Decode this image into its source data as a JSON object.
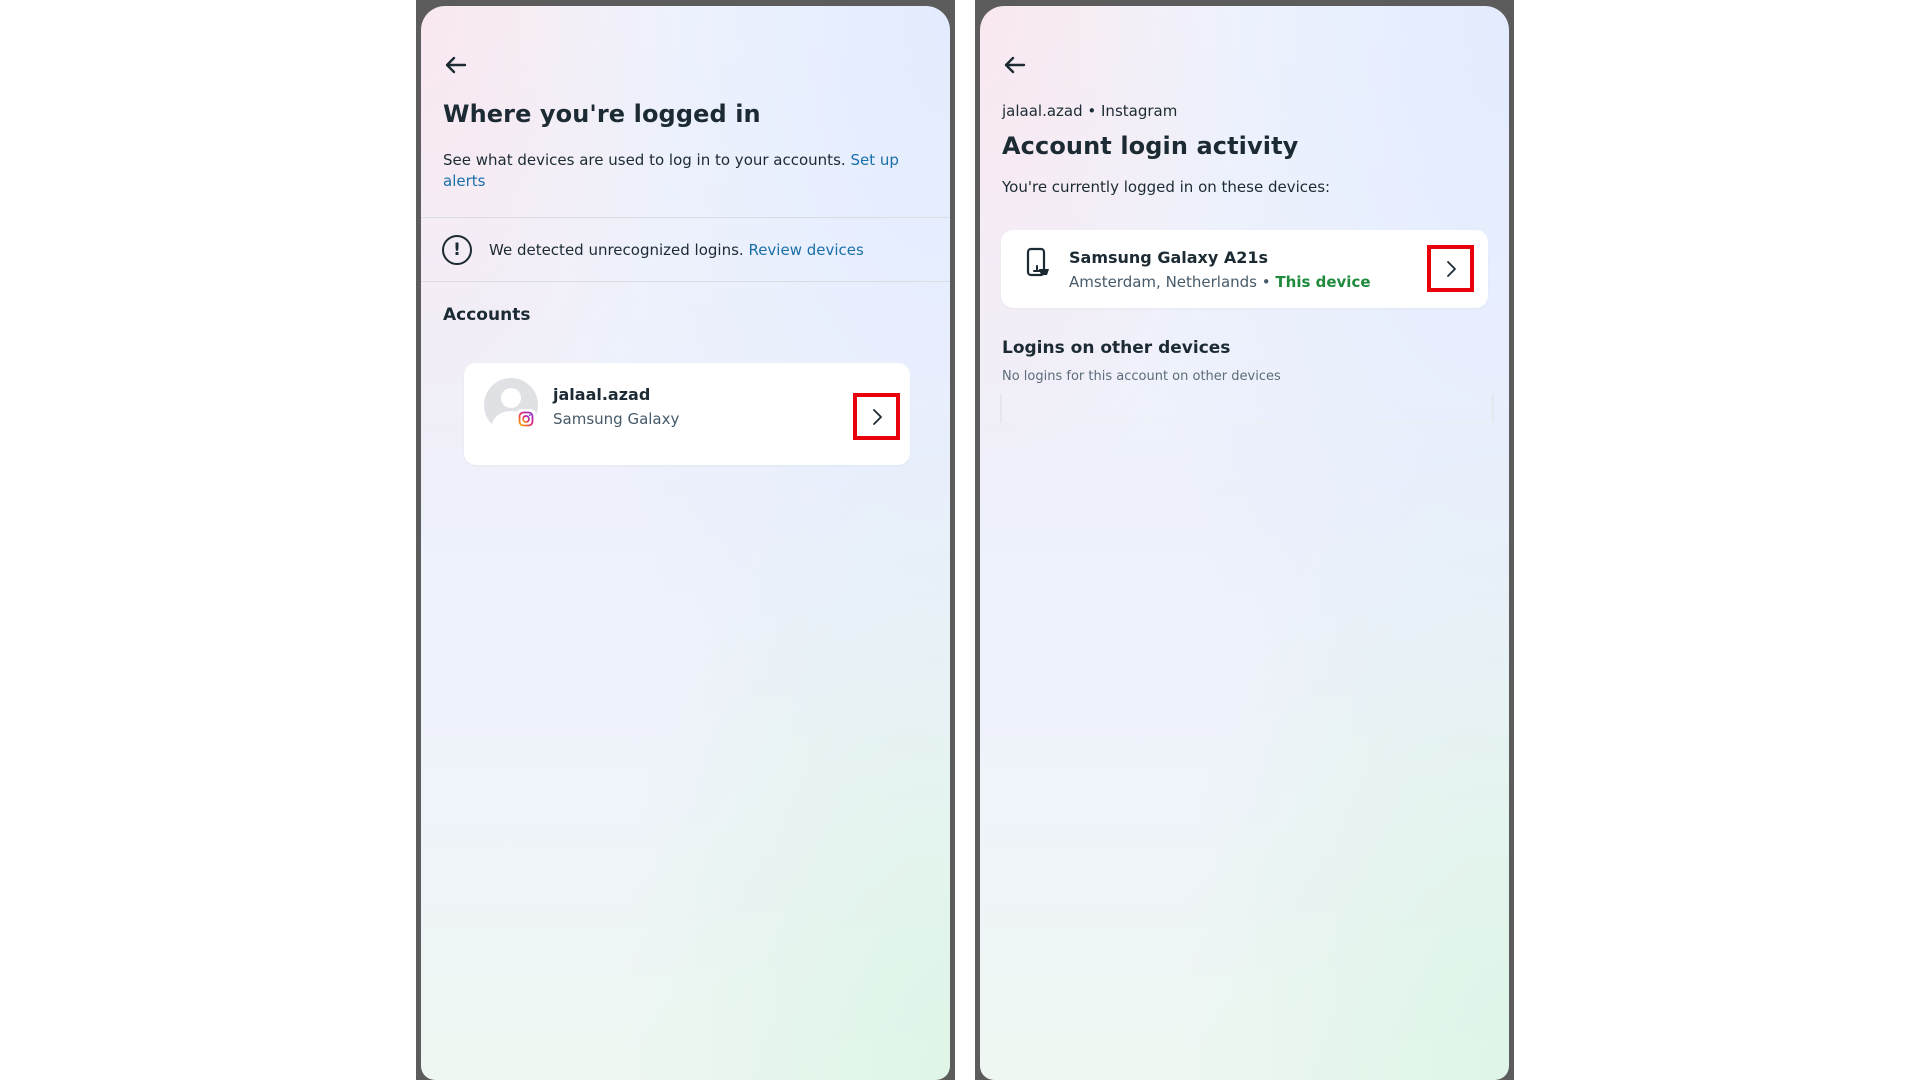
{
  "left_screen": {
    "title": "Where you're logged in",
    "description": "See what devices are used to log in to your accounts.",
    "setup_alerts_link": "Set up alerts",
    "alert": {
      "text": "We detected unrecognized logins.",
      "link": "Review devices"
    },
    "section_label": "Accounts",
    "account": {
      "username": "jalaal.azad",
      "device": "Samsung Galaxy"
    }
  },
  "right_screen": {
    "breadcrumb": "jalaal.azad • Instagram",
    "title": "Account login activity",
    "subtitle": "You're currently logged in on these devices:",
    "current_device": {
      "name": "Samsung Galaxy A21s",
      "location": "Amsterdam, Netherlands •",
      "status": "This device"
    },
    "other_devices_label": "Logins on other devices",
    "other_devices_empty": "No logins for this account on other devices"
  },
  "colors": {
    "highlight": "#e8000b",
    "link": "#1a6fa8",
    "this_device": "#1f8a3c"
  },
  "icons": {
    "back": "back-arrow-icon",
    "alert": "exclamation-circle-icon",
    "chevron": "chevron-right-icon",
    "phone": "mobile-phone-icon",
    "instagram": "instagram-icon"
  }
}
